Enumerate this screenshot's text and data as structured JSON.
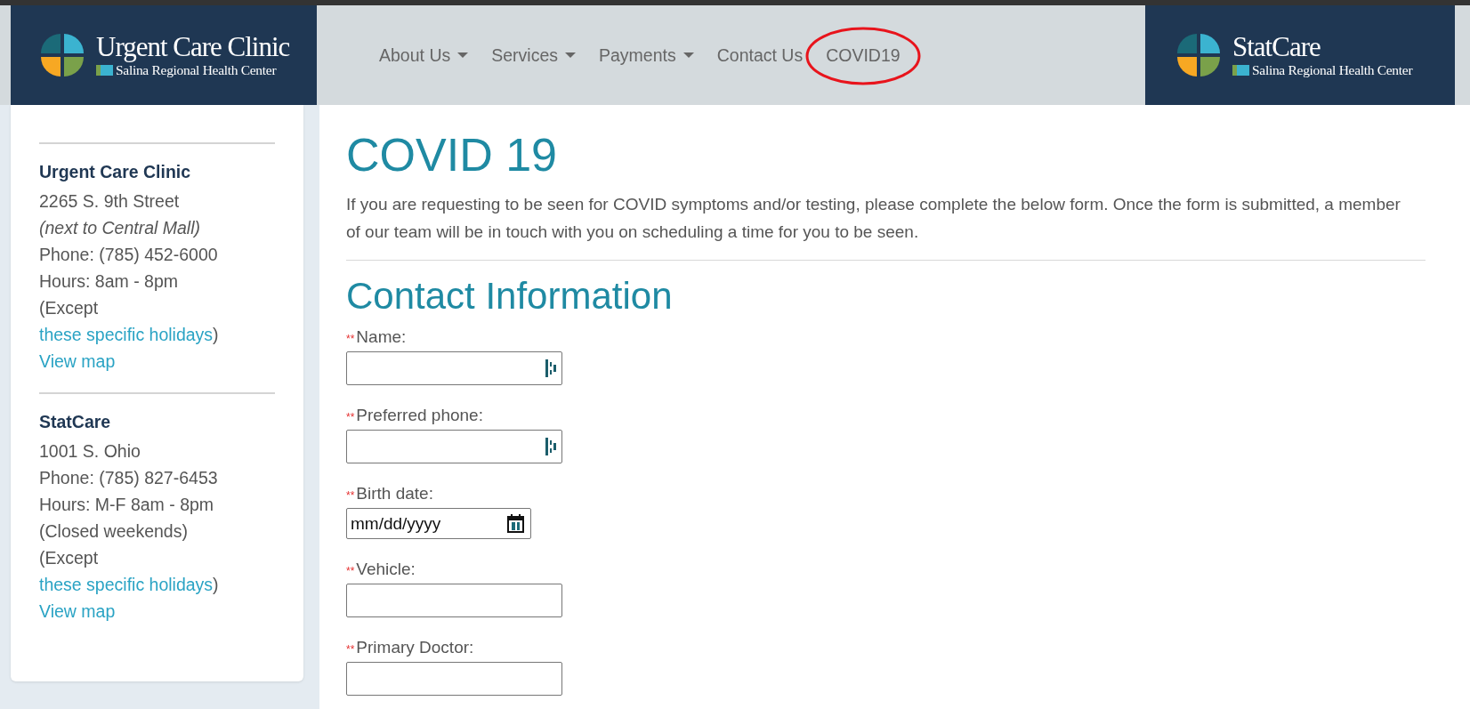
{
  "header": {
    "left_logo": {
      "title": "Urgent Care Clinic",
      "subtitle": "Salina Regional Health Center"
    },
    "nav": [
      {
        "label": "About Us",
        "dropdown": true,
        "circled": false
      },
      {
        "label": "Services",
        "dropdown": true,
        "circled": false
      },
      {
        "label": "Payments",
        "dropdown": true,
        "circled": false
      },
      {
        "label": "Contact Us",
        "dropdown": false,
        "circled": false
      },
      {
        "label": "COVID19",
        "dropdown": false,
        "circled": true
      }
    ],
    "right_logo": {
      "title": "StatCare",
      "subtitle": "Salina Regional Health Center"
    }
  },
  "sidebar": {
    "locations": [
      {
        "name": "Urgent Care Clinic",
        "lines": [
          {
            "kind": "plain",
            "text": "2265 S. 9th Street"
          },
          {
            "kind": "note",
            "text": "(next to Central Mall)"
          },
          {
            "kind": "plain",
            "text": "Phone: (785) 452-6000"
          },
          {
            "kind": "plain",
            "text": "Hours: 8am - 8pm"
          },
          {
            "kind": "linked",
            "before": "(Except",
            "link": "these specific holidays",
            "after": ")"
          },
          {
            "kind": "link",
            "text": "View map"
          }
        ]
      },
      {
        "name": "StatCare",
        "lines": [
          {
            "kind": "plain",
            "text": "1001 S. Ohio"
          },
          {
            "kind": "plain",
            "text": "Phone: (785) 827-6453"
          },
          {
            "kind": "plain",
            "text": "Hours: M-F 8am - 8pm"
          },
          {
            "kind": "plain",
            "text": "(Closed weekends)"
          },
          {
            "kind": "linked",
            "before": "(Except",
            "link": "these specific holidays",
            "after": ")"
          },
          {
            "kind": "link",
            "text": "View map"
          }
        ]
      }
    ]
  },
  "main": {
    "title": "COVID 19",
    "intro": "If you are requesting to be seen for COVID symptoms and/or testing, please complete the below form. Once the form is submitted, a member of our team will be in touch with you on scheduling a time for you to be seen.",
    "section_title": "Contact Information",
    "fields": [
      {
        "label": "Name:",
        "required": "**",
        "kind": "autofill"
      },
      {
        "label": "Preferred phone:",
        "required": "**",
        "kind": "autofill"
      },
      {
        "label": "Birth date:",
        "required": "**",
        "kind": "date",
        "placeholder": "mm/dd/yyyy"
      },
      {
        "label": "Vehicle:",
        "required": "**",
        "kind": "text"
      },
      {
        "label": "Primary Doctor:",
        "required": "**",
        "kind": "text"
      }
    ]
  }
}
